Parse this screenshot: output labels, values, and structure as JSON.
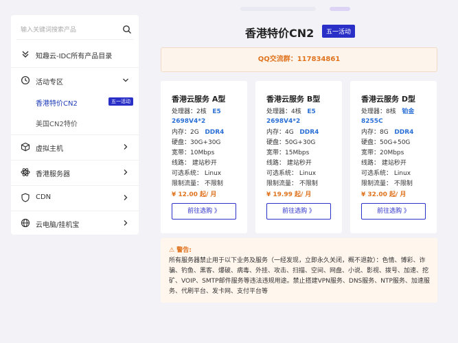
{
  "sidebar": {
    "search_placeholder": "输入关键词搜索产品",
    "catalog_label": "知趣云-IDC所有产品目录",
    "activity_label": "活动专区",
    "sub_items": [
      {
        "label": "香港特价CN2",
        "badge": "五一活动",
        "active": true
      },
      {
        "label": "美国CN2特价",
        "active": false
      }
    ],
    "nav": [
      {
        "label": "虚拟主机",
        "icon": "cube-icon"
      },
      {
        "label": "香港服务器",
        "icon": "atom-icon"
      },
      {
        "label": "CDN",
        "icon": "shield-icon"
      },
      {
        "label": "云电脑/挂机宝",
        "icon": "globe-icon"
      }
    ]
  },
  "main": {
    "title": "香港特价CN2",
    "title_badge": "五一活动",
    "qq_label": "QQ交流群：117834861"
  },
  "cards": [
    {
      "title": "香港云服务 A型",
      "cpu_label": "处理器：",
      "cpu_cores": "2核",
      "cpu_model_1": "E5",
      "cpu_model_2": "2698V4*2",
      "mem_label": "内存：",
      "mem_size": "2G",
      "mem_type": "DDR4",
      "disk": "硬盘：30G+30G",
      "bandwidth": "宽带：10Mbps",
      "line": "线路：   建站秒开",
      "os": "可选系统：   Linux",
      "traffic": "限制流量：   不限制",
      "price": "¥ 12.00 起/ 月",
      "button": "前往选购 》"
    },
    {
      "title": "香港云服务 B型",
      "cpu_label": "处理器：",
      "cpu_cores": "4核",
      "cpu_model_1": "E5",
      "cpu_model_2": "2698V4*2",
      "mem_label": "内存：",
      "mem_size": "4G",
      "mem_type": "DDR4",
      "disk": "硬盘：50G+30G",
      "bandwidth": "宽带：15Mbps",
      "line": "线路：   建站秒开",
      "os": "可选系统：   Linux",
      "traffic": "限制流量：   不限制",
      "price": "¥ 19.99 起/ 月",
      "button": "前往选购 》"
    },
    {
      "title": "香港云服务 D型",
      "cpu_label": "处理器：",
      "cpu_cores": "8核",
      "cpu_model_1": "铂金",
      "cpu_model_2": "8255C",
      "mem_label": "内存：",
      "mem_size": "8G",
      "mem_type": "DDR4",
      "disk": "硬盘：50G+50G",
      "bandwidth": "宽带：20Mbps",
      "line": "线路：   建站秒开",
      "os": "可选系统：   Linux",
      "traffic": "限制流量：   不限制",
      "price": "¥ 32.00 起/ 月",
      "button": "前往选购 》"
    }
  ],
  "warning": {
    "title": "⚠ 警告:",
    "body": "所有服务器禁止用于以下业务及服务（一经发现，立即永久关闭，概不退款）：色情、博彩、诈骗、钓鱼、黑客、爆破、病毒、外挂、攻击、扫描、空间、网盘、小说、影视、拨号、加速、挖矿、VOIP、SMTP邮件服务等违法违规用途。禁止搭建VPN服务、DNS服务、NTP服务、加速服务、代刷平台、发卡网、支付平台等"
  },
  "colors": {
    "accent_blue": "#2a2fc7",
    "orange": "#e0731e",
    "highlight_blue": "#2a6fd6"
  }
}
